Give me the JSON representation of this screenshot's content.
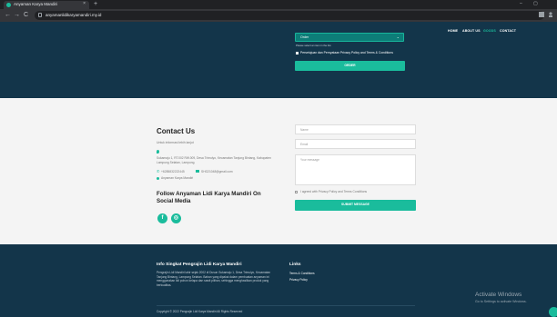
{
  "browser": {
    "tab_title": "Anyaman Karya Mandiri",
    "tab_close": "×",
    "new_tab": "+",
    "url": "anyamanlidikaryamandiri.my.id",
    "back": "←",
    "forward": "→",
    "reload": "C",
    "window_minimize": "–",
    "window_restore": "▢"
  },
  "nav": {
    "items": [
      "HOME",
      "ABOUT US",
      "GOODS",
      "CONTACT"
    ],
    "active": "GOODS"
  },
  "hero": {
    "select_value": "Order",
    "select_chevron": "⌄",
    "note": "Please select an item in the list.",
    "consent": "Persetujuan dan Pernyataan Privacy Policy and Terms & Conditions",
    "submit_label": "ORDER"
  },
  "contact": {
    "title": "Contact Us",
    "subtitle": "Untuk informasi lebih lanjut",
    "address": "Sukamaju 1, RT.002 RW.009, Desa Trimulyo, Kecamatan Tanjung Bintang, Kabupaten Lampung Selatan, Lampung.",
    "phone_icon": "✆",
    "phone": "+6285832222445",
    "email": "SHG21048@gmail.com",
    "website": "Anyaman Karya Mandiri",
    "social_title": "Follow Anyaman Lidi Karya Mandiri On Social Media",
    "social_facebook": "f",
    "social_instagram": "◎",
    "form": {
      "name_placeholder": "Name",
      "email_placeholder": "Email",
      "message_placeholder": "Your message",
      "agree": "I agreed with Privacy Policy and Terms Conditions",
      "submit_label": "SUBMIT MESSAGE"
    }
  },
  "footer": {
    "title": "Info Singkat Pengrajin Lidi Karya Mandiri",
    "description": "Pengrajin Lidi Mandiri lahir sejak 2002 di Dusun Sukamaju 1, Desa Trimulyo, Kecamatan Tanjung Bintang, Lampung Selatan. Bahan yang dipakai dalam pembuatan anyaman ini menggunakan lidi pohon kelapa dan sawit pilihan, sehingga menghasilkan produk yang berkualitas.",
    "links_title": "Links",
    "links": [
      "Terms & Conditions",
      "Privacy Policy"
    ],
    "copyright": "Copyright © 2022 Pengrajin Lidi Karya Mandiri All Rights Reserved"
  },
  "watermark": {
    "title": "Activate Windows",
    "subtitle": "Go to Settings to activate Windows."
  },
  "colors": {
    "accent": "#1abc9c",
    "dark_navy": "#13354a"
  }
}
